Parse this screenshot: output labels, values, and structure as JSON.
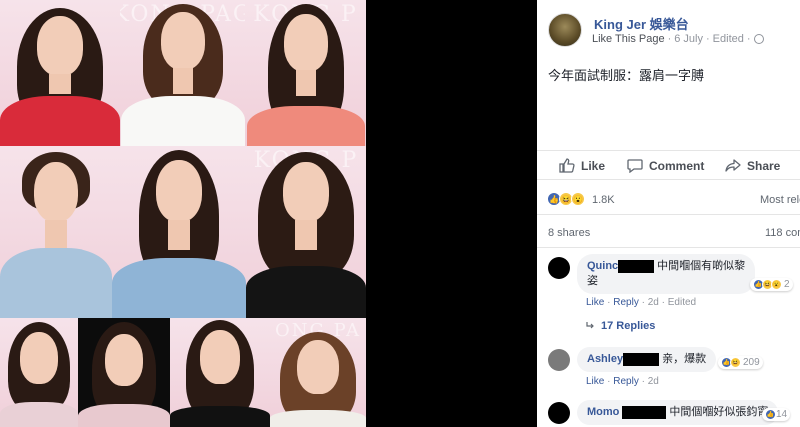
{
  "post": {
    "page_name": "King Jer 娛樂台",
    "like_this_page": "Like This Page",
    "date": "6 July",
    "edited": "Edited",
    "text": "今年面試制服：露肩一字膊"
  },
  "actions": {
    "like": "Like",
    "comment": "Comment",
    "share": "Share"
  },
  "reactions": {
    "count": "1.8K",
    "most_relevant": "Most rele"
  },
  "stats": {
    "shares": "8 shares",
    "comments": "118 com"
  },
  "comments": [
    {
      "name": "Quinc",
      "text_line1": "中間嗰個有啲似黎",
      "text_line2": "姿",
      "like": "Like",
      "reply": "Reply",
      "time": "2d",
      "edited": "Edited",
      "reaction_count": "2"
    },
    {
      "name": "Ashley",
      "text": "亲，爆款",
      "like": "Like",
      "reply": "Reply",
      "time": "2d",
      "reaction_count": "209"
    },
    {
      "name": "Momo",
      "text": "中間個嗰好似張鈞甯",
      "reaction_count": "14"
    }
  ],
  "replies_label": "17 Replies",
  "photo_watermarks": [
    "KONG PAG",
    "KONG P",
    "KONG P",
    "ONG PA"
  ],
  "colors": {
    "fb_blue": "#385898",
    "muted": "#90949c",
    "bubble": "#f2f3f5"
  }
}
